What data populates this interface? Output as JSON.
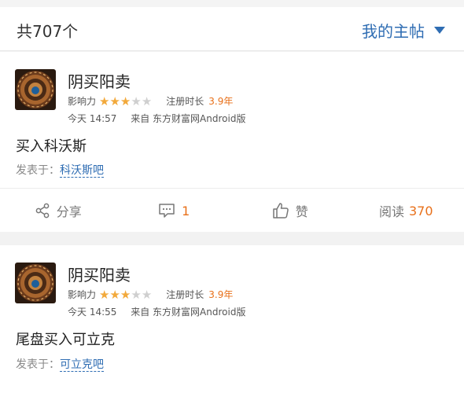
{
  "header": {
    "count": "共707个",
    "filter": "我的主帖"
  },
  "posts": [
    {
      "username": "阴买阳卖",
      "influence_label": "影响力",
      "influence_stars": 3,
      "influence_max": 5,
      "reg_label": "注册时长",
      "reg_value": "3.9年",
      "time": "今天 14:57",
      "source": "来自 东方财富网Android版",
      "content": "买入科沃斯",
      "posted_to_label": "发表于：",
      "bar": "科沃斯吧",
      "actions": {
        "share": "分享",
        "comments": "1",
        "like": "赞",
        "read_label": "阅读",
        "read_count": "370"
      }
    },
    {
      "username": "阴买阳卖",
      "influence_label": "影响力",
      "influence_stars": 3,
      "influence_max": 5,
      "reg_label": "注册时长",
      "reg_value": "3.9年",
      "time": "今天 14:55",
      "source": "来自 东方财富网Android版",
      "content": "尾盘买入可立克",
      "posted_to_label": "发表于：",
      "bar": "可立克吧"
    }
  ],
  "colors": {
    "accent": "#2f6db3",
    "orange": "#e8701a",
    "star": "#f2a93b"
  }
}
